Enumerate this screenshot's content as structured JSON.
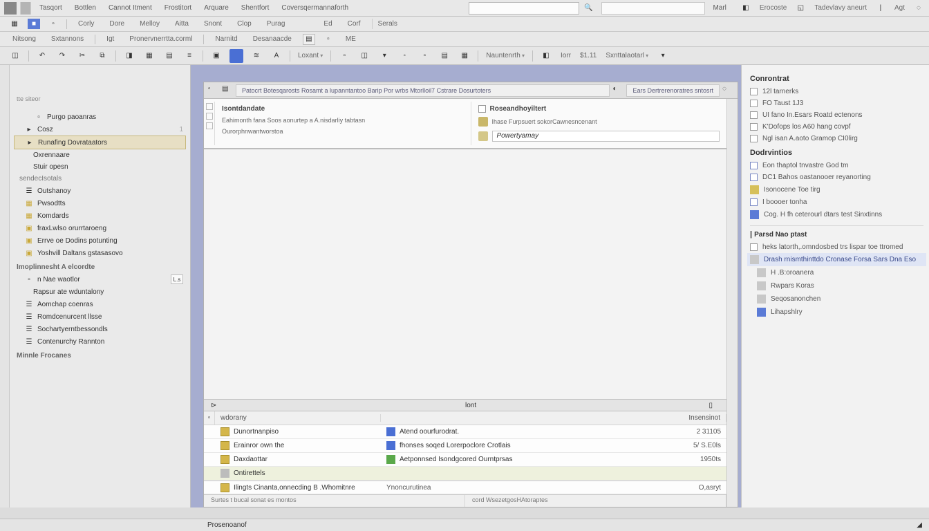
{
  "menubar": {
    "items": [
      "Tasqort",
      "Bottlen",
      "Cannot Itment",
      "Frostitort",
      "Arquare",
      "Shentfort",
      "Coversqermannaforth"
    ],
    "rightItems": [
      "Erocoste",
      "Tadevlavy aneurt",
      "Agt"
    ],
    "mailLabel": "Marl",
    "searchHint": ""
  },
  "toolbar1": {
    "btns": [
      "",
      "Corly",
      "Dore",
      "Melloy",
      "Aitta",
      "Snont",
      "Clop",
      "Purag",
      "Ed",
      "Corf",
      "Serals"
    ],
    "activeIdx": 1
  },
  "toolbar2": {
    "btns": [
      "Nitsong",
      "Sxtannons",
      "Igt",
      "Pronervnerrtta.corml",
      "Narnitd",
      "Desanaacde",
      "ME"
    ]
  },
  "ribbon": {
    "labels": [
      "Loxant",
      "",
      "Nauntenrth",
      "Iorr",
      "Sxnttalaotarl"
    ],
    "num": "$1.11"
  },
  "sidebar": {
    "top": "tte siteor",
    "boxLabel": "Purgo paoanras",
    "rootLabel": "Cosz",
    "selected": "Runafing Dovrataators",
    "items1": [
      "Oxrennaare",
      "Stuir opesn"
    ],
    "hdr1": "sendecIsotals",
    "items2": [
      "Outshanoy",
      "Pwsodtts",
      "Komdards",
      "fraxLwlso orurrtaroeng",
      "Errve oe Dodins potunting",
      "Yoshvill Daltans gstasasovo"
    ],
    "hdr2": "Imoplinnesht A elcordte",
    "monitor": "n Nae waotlor",
    "monitorBadge": "L.s",
    "items3": [
      "Rapsur ate wduntalony",
      "Aomchap coenras",
      "Romdcenurcent llsse",
      "Sochartyerntbessondls",
      "Contenurchy Rannton"
    ],
    "hdr3": "Minnle Frocanes"
  },
  "doc": {
    "tabMain": "Patocrt Botesqarosts Rosamt a lupanntantoo Barip Por wrbs Mtorlloil7 Cstrare Dosurtoters",
    "tabSide": "Ears   Dertrerenoratres sntosrt",
    "form": {
      "leftLabel": "Isontdandate",
      "leftSub": "Eahimonth fana Soos aonurtep a A.nisdarliy tabtasn",
      "leftSub2": "Ourorphnwantworstoa",
      "rightLabel": "Roseandhoyiltert",
      "rightSub": "Ihase  Furpsuert sokorCawnesncenant",
      "rightHint": "Powertyamay"
    },
    "gridTopMarks": {
      "left": "",
      "center": "lont",
      "right": ""
    },
    "gridHeader": {
      "c1": "wdorany",
      "c2": "",
      "c3": "Insensinot"
    },
    "rows": [
      {
        "name": "Dunortnanpiso",
        "desc": "Atend oourfurodrat.",
        "val": "2  31105",
        "icon": "blue"
      },
      {
        "name": "Erainror own the",
        "desc": "fhonses soqed Lorerpoclore Crotlais",
        "val": "5/ S.E0ls",
        "icon": "blue"
      },
      {
        "name": "Daxdaottar",
        "desc": "Aetponnsed  Isondgcored Ourntprsas",
        "val": "1950ts",
        "icon": "grn"
      },
      {
        "name": "Ontirettels",
        "desc": "",
        "val": "",
        "icon": "gry"
      }
    ],
    "subRow": {
      "name": "Ilingts Cinanta,onnecding B .Whomitnre",
      "desc": "Ynoncurutinea",
      "val": "O,asryt"
    },
    "footer": {
      "left": "Surtes t bucal sonat es montos",
      "center": "cord WsezetgosHAtoraptes"
    }
  },
  "rpanel": {
    "h1": "Conrontrat",
    "g1": [
      "12l tarnerks",
      "FO Taust 1J3",
      "UI fano In.Esars Roatd ectenons",
      "K'Dofops los A60 hang covpf",
      "Ngl isan A.aoto Gramop CI0lirg"
    ],
    "h2": "Dodrvintios",
    "g2": [
      "Eon thaptol tnvastre God tm",
      "DC1 Bahos oastanooer reyanorting",
      "Isonocene Toe tirg",
      "I boooer tonha",
      "Cog. H fh ceterourl dtars test Sinxtinns"
    ],
    "h3": "Parsd Nao ptast",
    "g3Lead": "heks latorth,.omndosbed trs lispar toe ttromed",
    "g3Sel": "Drash rnismthinttdo Cronase Forsa Sars Dna Eso",
    "g3": [
      "H .B:oroanera",
      "Rwpars Koras",
      "Seqosanonchen",
      "Lihapshlry"
    ]
  },
  "status": {
    "left": "",
    "center": "Prosenoanof",
    "right": ""
  }
}
